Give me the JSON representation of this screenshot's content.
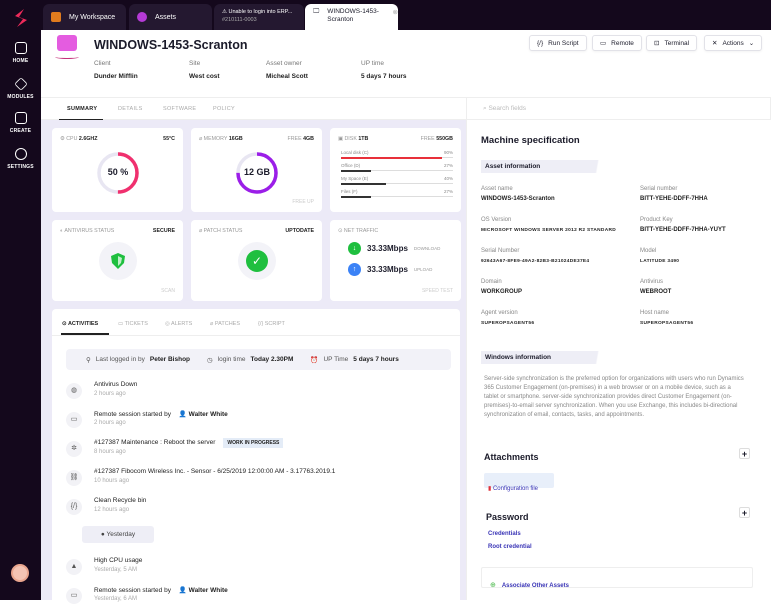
{
  "sidebar": {
    "items": [
      {
        "label": "HOME"
      },
      {
        "label": "MODULES"
      },
      {
        "label": "CREATE"
      },
      {
        "label": "SETTINGS"
      }
    ]
  },
  "tabs": [
    {
      "label": "My Workspace"
    },
    {
      "label": "Assets"
    },
    {
      "label": "Unable to login into ERP...",
      "sub": "#210111-0003"
    },
    {
      "label": "WINDOWS-1453-Scranton"
    }
  ],
  "header": {
    "title": "WINDOWS-1453-Scranton",
    "meta": [
      {
        "label": "Client",
        "value": "Dunder Mifflin"
      },
      {
        "label": "Site",
        "value": "West cost"
      },
      {
        "label": "Asset owner",
        "value": "Micheal Scott"
      },
      {
        "label": "UP time",
        "value": "5 days 7 hours"
      }
    ],
    "buttons": {
      "run_script": "Run Script",
      "remote": "Remote",
      "terminal": "Terminal",
      "actions": "Actions"
    }
  },
  "subtabs": [
    "SUMMARY",
    "DETAILS",
    "SOFTWARE",
    "POLICY"
  ],
  "search": {
    "placeholder": "Search fields"
  },
  "cards": {
    "cpu": {
      "label": "CPU",
      "value": "2.6GHZ",
      "temp": "55°C",
      "usage": "50 %",
      "percent": 50
    },
    "memory": {
      "label": "MEMORY",
      "value": "16GB",
      "free_label": "FREE",
      "free": "4GB",
      "used": "12 GB",
      "percent": 75,
      "footer": "FREE UP"
    },
    "disk": {
      "label": "DISK",
      "value": "1TB",
      "free_label": "FREE",
      "free": "550GB",
      "drives": [
        {
          "name": "Local disk (C)",
          "pct": "90%",
          "value": 90
        },
        {
          "name": "Office (D)",
          "pct": "27%",
          "value": 27
        },
        {
          "name": "My Space (E)",
          "pct": "40%",
          "value": 40
        },
        {
          "name": "Files (F)",
          "pct": "27%",
          "value": 27
        }
      ]
    },
    "antivirus": {
      "label": "ANTIVIRUS STATUS",
      "status": "SECURE",
      "footer": "SCAN"
    },
    "patch": {
      "label": "PATCH STATUS",
      "status": "UPTODATE"
    },
    "net": {
      "label": "NET TRAFFIC",
      "download": "33.33Mbps",
      "download_label": "DOWNLOAD",
      "upload": "33.33Mbps",
      "upload_label": "UPLOAD",
      "footer": "SPEED TEST"
    }
  },
  "activity": {
    "tabs": [
      "ACTIVITIES",
      "TICKETS",
      "ALERTS",
      "PATCHES",
      "SCRIPT"
    ],
    "login": {
      "last_label": "Last logged in by",
      "user": "Peter Bishop",
      "time_label": "login time",
      "time": "Today 2.30PM",
      "up_label": "UP Time",
      "up": "5 days 7 hours"
    },
    "items": [
      {
        "title": "Antivirus Down",
        "time": "2 hours ago"
      },
      {
        "title": "Remote session started by",
        "user": "Walter White",
        "time": "2 hours ago"
      },
      {
        "title": "#127387  Maintenance : Reboot the server",
        "badge": "WORK IN PROGRESS",
        "time": "8 hours ago"
      },
      {
        "title": "#127387  Fibocom Wireless Inc. - Sensor - 6/25/2019 12:00:00 AM - 3.17763.2019.1",
        "time": "10 hours ago"
      },
      {
        "title": "Clean Recycle bin",
        "time": "12 hours ago"
      }
    ],
    "divider": "Yesterday",
    "items2": [
      {
        "title": "High CPU usage",
        "time": "Yesterday, 5 AM"
      },
      {
        "title": "Remote session started by",
        "user": "Walter White",
        "time": "Yesterday, 6 AM"
      }
    ]
  },
  "spec": {
    "title": "Machine specification",
    "asset_info": "Asset information",
    "fields": [
      {
        "label": "Asset name",
        "value": "WINDOWS-1453-Scranton"
      },
      {
        "label": "Serial number",
        "value": "BITT-YEHE-DDFF-7HHA"
      },
      {
        "label": "OS Version",
        "value": "MICROSOFT WINDOWS SERVER 2012 R2 STANDARD"
      },
      {
        "label": "Product Key",
        "value": "BITT-YEHE-DDFF-7HHA-YUYT"
      },
      {
        "label": "Serial Number",
        "value": "92643A67-8FE9-49A2-82B3-B21024DE37E4"
      },
      {
        "label": "Model",
        "value": "LATITUDE 3490"
      },
      {
        "label": "Domain",
        "value": "WORKGROUP"
      },
      {
        "label": "Antivirus",
        "value": "WEBROOT"
      },
      {
        "label": "Agent version",
        "value": "SUPEROPSAGENT56"
      },
      {
        "label": "Host name",
        "value": "SUPEROPSAGENT56"
      }
    ],
    "windows_info": "Windows information",
    "description": "Server-side synchronization is the preferred option for organizations with users who run Dynamics 365 Customer Engagement (on-premises) in a web browser or on a mobile device, such as a tablet or smartphone. server-side synchronization provides direct Customer Engagement (on-premises)-to-email server synchronization. When you use Exchange, this includes bi-directional synchronization of email, contacts, tasks, and appointments.",
    "attachments": "Attachments",
    "config_file": "Configuration file",
    "password": "Password",
    "credentials": "Credentials",
    "root_credential": "Root credential",
    "associate": "Associate Other Assets"
  },
  "colors": {
    "sidebar": "#14081c",
    "accent": "#3a35b6",
    "cpu_ring": "#f0306e",
    "memory_ring": "#9b1ee8",
    "success": "#1fbf3f",
    "upload": "#3b82f6"
  }
}
